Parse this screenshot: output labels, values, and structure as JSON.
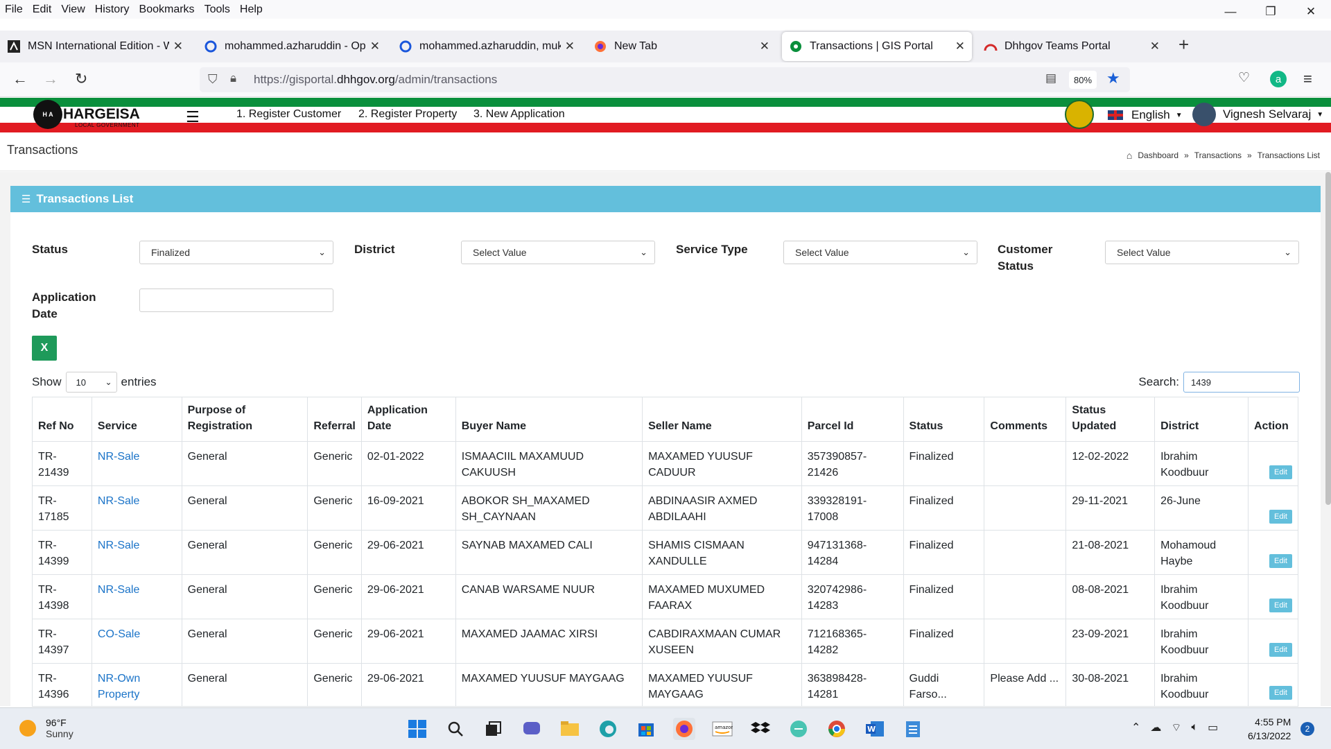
{
  "menubar": {
    "items": [
      "File",
      "Edit",
      "View",
      "History",
      "Bookmarks",
      "Tools",
      "Help"
    ]
  },
  "window_controls": {
    "minimize": "—",
    "restore": "❐",
    "close": "✕"
  },
  "tabs": [
    {
      "title": "MSN International Edition - Wo",
      "icon": "msn-icon"
    },
    {
      "title": "mohammed.azharuddin - Opera",
      "icon": "opera-icon"
    },
    {
      "title": "mohammed.azharuddin, mukth",
      "icon": "opera-icon"
    },
    {
      "title": "New Tab",
      "icon": "firefox-icon"
    },
    {
      "title": "Transactions | GIS Portal",
      "icon": "gis-icon",
      "active": true
    },
    {
      "title": "Dhhgov Teams Portal",
      "icon": "teams-icon"
    }
  ],
  "address": {
    "prefix": "https://gisportal.",
    "domain": "dhhgov.org",
    "path": "/admin/transactions",
    "zoom": "80%"
  },
  "portal": {
    "logo_text": "HARGEISA",
    "logo_sub": "LOCAL GOVERNMENT",
    "logo_badge": "H A",
    "nav": [
      "1. Register Customer",
      "2. Register Property",
      "3. New Application"
    ],
    "language": "English",
    "user": "Vignesh Selvaraj"
  },
  "page": {
    "title": "Transactions",
    "breadcrumbs": [
      "Dashboard",
      "Transactions",
      "Transactions List"
    ],
    "card_title": "Transactions List"
  },
  "filters": {
    "status_label": "Status",
    "status_value": "Finalized",
    "district_label": "District",
    "district_value": "Select Value",
    "service_type_label": "Service Type",
    "service_type_value": "Select Value",
    "customer_status_label_1": "Customer",
    "customer_status_label_2": "Status",
    "customer_status_value": "Select Value",
    "application_date_label_1": "Application",
    "application_date_label_2": "Date"
  },
  "list_controls": {
    "show_label": "Show",
    "page_size": "10",
    "entries_label": "entries",
    "search_label": "Search:",
    "search_value": "1439"
  },
  "table": {
    "headers": [
      "Ref No",
      "Service",
      "Purpose of Registration",
      "Referral",
      "Application Date",
      "Buyer Name",
      "Seller Name",
      "Parcel Id",
      "Status",
      "Comments",
      "Status Updated",
      "District",
      "Action"
    ],
    "edit_label": "Edit",
    "rows": [
      [
        "TR-21439",
        "NR-Sale",
        "General",
        "Generic",
        "02-01-2022",
        "ISMAACIIL MAXAMUUD CAKUUSH",
        "MAXAMED YUUSUF CADUUR",
        "357390857-21426",
        "Finalized",
        "",
        "12-02-2022",
        "Ibrahim Koodbuur"
      ],
      [
        "TR-17185",
        "NR-Sale",
        "General",
        "Generic",
        "16-09-2021",
        "ABOKOR SH_MAXAMED SH_CAYNAAN",
        "ABDINAASIR AXMED ABDILAAHI",
        "339328191-17008",
        "Finalized",
        "",
        "29-11-2021",
        "26-June"
      ],
      [
        "TR-14399",
        "NR-Sale",
        "General",
        "Generic",
        "29-06-2021",
        "SAYNAB MAXAMED CALI",
        "SHAMIS CISMAAN XANDULLE",
        "947131368-14284",
        "Finalized",
        "",
        "21-08-2021",
        "Mohamoud Haybe"
      ],
      [
        "TR-14398",
        "NR-Sale",
        "General",
        "Generic",
        "29-06-2021",
        "CANAB WARSAME NUUR",
        "MAXAMED MUXUMED FAARAX",
        "320742986-14283",
        "Finalized",
        "",
        "08-08-2021",
        "Ibrahim Koodbuur"
      ],
      [
        "TR-14397",
        "CO-Sale",
        "General",
        "Generic",
        "29-06-2021",
        "MAXAMED JAAMAC XIRSI",
        "CABDIRAXMAAN CUMAR XUSEEN",
        "712168365-14282",
        "Finalized",
        "",
        "23-09-2021",
        "Ibrahim Koodbuur"
      ],
      [
        "TR-14396",
        "NR-Own Property",
        "General",
        "Generic",
        "29-06-2021",
        "MAXAMED YUUSUF MAYGAAG",
        "MAXAMED YUUSUF MAYGAAG",
        "363898428-14281",
        "Guddi Farso...",
        "Please Add ...",
        "30-08-2021",
        "Ibrahim Koodbuur"
      ]
    ]
  },
  "taskbar": {
    "weather_temp": "96°F",
    "weather_desc": "Sunny",
    "time": "4:55 PM",
    "date": "6/13/2022",
    "notifications": "2",
    "apps": [
      "windows-start-icon",
      "search-icon",
      "task-view-icon",
      "teams-chat-icon",
      "file-explorer-icon",
      "edge-icon",
      "store-icon",
      "firefox-icon",
      "amazon-icon",
      "dropbox-icon",
      "messaging-icon",
      "chrome-icon",
      "word-icon",
      "notepad-icon"
    ]
  },
  "colors": {
    "card_header": "#63bfdc",
    "flag_green": "#0a8f3c",
    "flag_red": "#e11b22",
    "link": "#1a73c8"
  }
}
